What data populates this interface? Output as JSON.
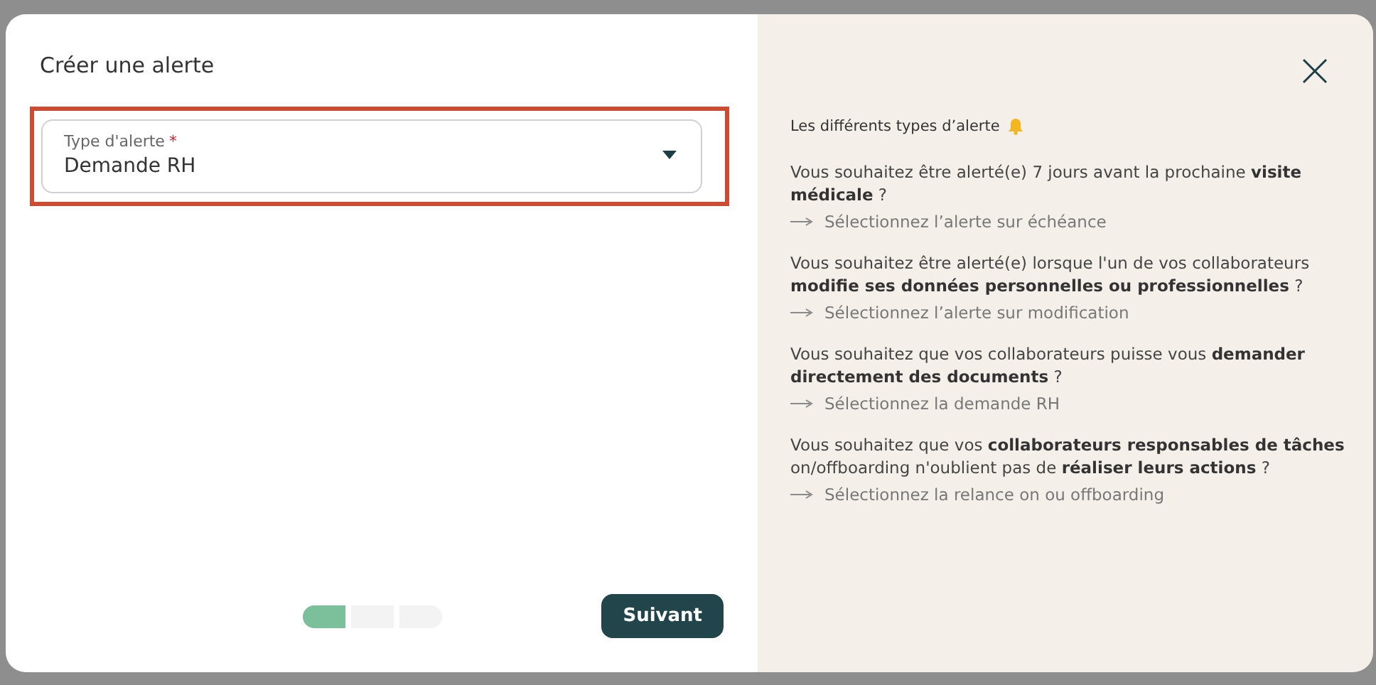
{
  "dialog": {
    "title": "Créer une alerte"
  },
  "field": {
    "label": "Type d'alerte",
    "required_mark": "*",
    "value": "Demande RH",
    "highlighted": true
  },
  "steps": [
    {
      "completed": true
    },
    {
      "completed": false
    },
    {
      "completed": false
    }
  ],
  "next_button": "Suivant",
  "help": {
    "heading": "Les différents types d’alerte",
    "tips": [
      {
        "question": "Vous souhaitez être alerté(e) 7 jours avant la prochaine **visite médicale** ?",
        "action": "Sélectionnez l’alerte sur échéance"
      },
      {
        "question": "Vous souhaitez être alerté(e) lorsque l'un de vos collaborateurs **modifie ses données personnelles ou professionnelles** ?",
        "action": "Sélectionnez l’alerte sur modification"
      },
      {
        "question": "Vous souhaitez que vos collaborateurs puisse vous **demander directement des documents** ?",
        "action": "Sélectionnez la demande RH"
      },
      {
        "question": "Vous souhaitez que vos **collaborateurs responsables de tâches** on/offboarding n'oublient pas de **réaliser leurs actions** ?",
        "action": "Sélectionnez la relance on ou offboarding"
      }
    ]
  }
}
